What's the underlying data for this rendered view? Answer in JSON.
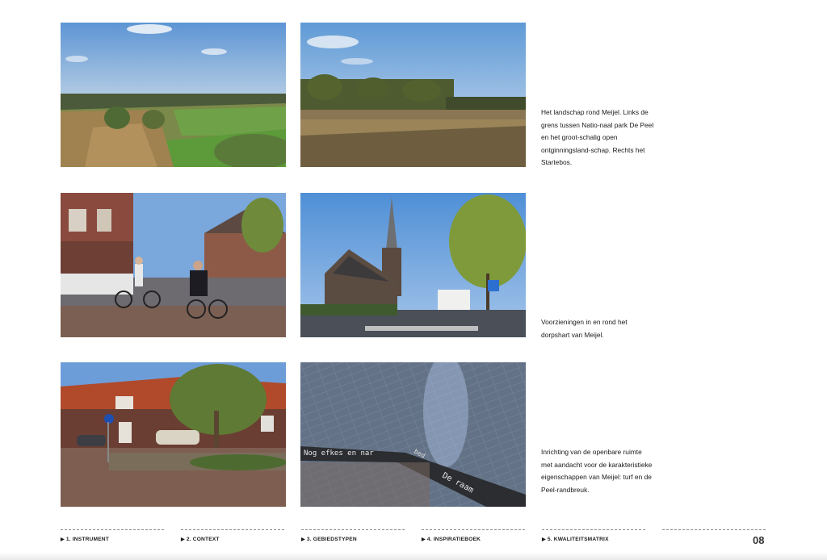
{
  "captions": [
    "Het landschap rond Meijel. Links de grens tussen Natio-naal park De Peel en het groot-schalig open ontginningsland-schap. Rechts het Startebos.",
    "Voorzieningen in en rond het dorpshart van Meijel.",
    "Inrichting van de openbare ruimte met aandacht voor de karakteristieke eigenschappen van Meijel: turf en de Peel-randbreuk."
  ],
  "photo_text": {
    "pavement_line1": "Nog efkes en nar",
    "pavement_word": "bed",
    "pavement_line2": "De raam"
  },
  "footer": {
    "nav": [
      "1. INSTRUMENT",
      "2. CONTEXT",
      "3. GEBIEDSTYPEN",
      "4. INSPIRATIEBOEK",
      "5. KWALITEITSMATRIX"
    ],
    "triangle": "▶",
    "page_number": "08"
  },
  "colors": {
    "sky": "#7fa9d6",
    "grass": "#6f9a43",
    "brick": "#8a5a48",
    "paving": "#5f6670"
  }
}
